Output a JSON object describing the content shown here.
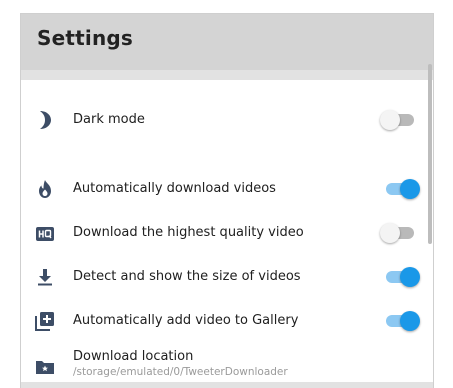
{
  "header": {
    "title": "Settings"
  },
  "settings": [
    {
      "label": "Dark mode",
      "icon": "moon-icon",
      "toggle": "off"
    },
    {
      "label": "Automatically download videos",
      "icon": "flame-icon",
      "toggle": "on"
    },
    {
      "label": "Download the highest quality video",
      "icon": "hq-icon",
      "toggle": "off"
    },
    {
      "label": "Detect and show the size of videos",
      "icon": "download-arrow-icon",
      "toggle": "on"
    },
    {
      "label": "Automatically add video to Gallery",
      "icon": "add-to-library-icon",
      "toggle": "on"
    },
    {
      "label": "Download location",
      "sub": "/storage/emulated/0/TweeterDownloader",
      "icon": "folder-star-icon"
    }
  ],
  "colors": {
    "accent": "#1a98e8",
    "accent_track": "#8cc8f2",
    "header_bg": "#d4d4d4",
    "icon": "#3d4d66"
  }
}
